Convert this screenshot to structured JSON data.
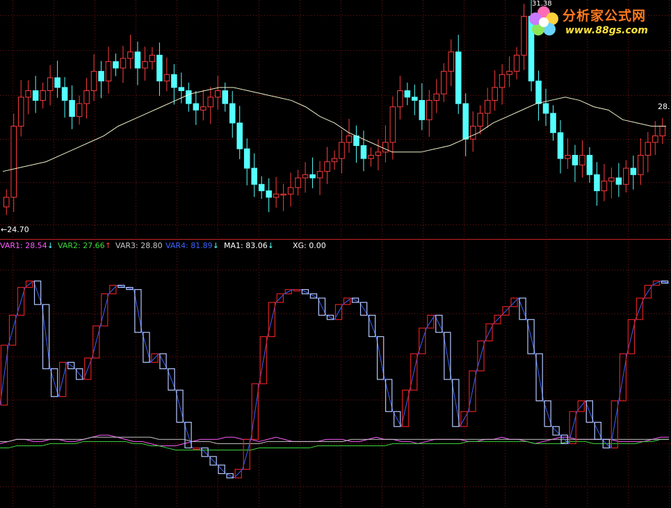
{
  "colors": {
    "background": "#000000",
    "grid": "#7a1212",
    "up": "#ff3c3c",
    "down": "#54ffff",
    "ma_line": "#f0f0c8",
    "divider": "#b41c1c",
    "var1": "#ff5cff",
    "var2": "#3cdc3c",
    "var3": "#c8c8c8",
    "var4": "#3c64ff",
    "ma1": "#ffffff",
    "xg": "#ffffff",
    "osc_up": "#e02020",
    "osc_down": "#b4c8ff"
  },
  "watermark": {
    "brand": "分析家公式网",
    "url": "www.88gs.com",
    "icon": "flower-logo"
  },
  "legend": [
    {
      "label": "VAR1: 28.54",
      "arrow": "↓",
      "arrow_dir": "down",
      "color": "#ff5cff"
    },
    {
      "label": "VAR2: 27.66",
      "arrow": "↑",
      "arrow_dir": "up",
      "color": "#3cdc3c"
    },
    {
      "label": "VAR3: 28.80",
      "arrow": "",
      "color": "#c8c8c8"
    },
    {
      "label": "VAR4: 81.89",
      "arrow": "↓",
      "arrow_dir": "down",
      "color": "#3c64ff"
    },
    {
      "label": "MA1: 83.06",
      "arrow": "↓",
      "arrow_dir": "down",
      "color": "#ffffff"
    },
    {
      "label": "XG: 0.00",
      "arrow": "",
      "color": "#ffffff"
    }
  ],
  "chart_data": [
    {
      "type": "candlestick",
      "panel": "price",
      "min_label": "←24.70",
      "right_label": "28.",
      "top_label": "31.38",
      "ylim": [
        24.5,
        31.6
      ],
      "grid": true,
      "ohlc_closes": [
        25.6,
        27.8,
        28.7,
        28.9,
        28.6,
        28.9,
        29.3,
        29.0,
        28.6,
        28.1,
        28.5,
        28.9,
        29.5,
        29.2,
        29.8,
        29.6,
        29.9,
        30.1,
        29.6,
        29.8,
        30.0,
        29.2,
        29.4,
        29.0,
        28.9,
        28.5,
        28.3,
        28.4,
        28.7,
        28.9,
        28.5,
        27.9,
        27.1,
        26.5,
        26.0,
        25.8,
        25.6,
        25.7,
        25.7,
        25.9,
        26.2,
        26.3,
        26.2,
        26.4,
        26.7,
        26.8,
        27.3,
        27.5,
        27.2,
        26.8,
        26.9,
        27.0,
        27.3,
        28.4,
        28.9,
        28.7,
        28.6,
        28.0,
        28.6,
        28.8,
        29.5,
        30.1,
        28.5,
        27.4,
        27.8,
        28.2,
        28.6,
        29.0,
        29.4,
        29.5,
        30.0,
        31.2,
        29.2,
        28.5,
        28.2,
        27.6,
        26.8,
        26.9,
        26.6,
        26.9,
        26.3,
        25.8,
        26.1,
        26.2,
        26.0,
        26.5,
        26.3,
        26.9,
        27.3,
        27.5,
        27.8
      ],
      "ma_line": [
        26.4,
        26.5,
        26.6,
        26.7,
        26.9,
        27.1,
        27.3,
        27.5,
        27.8,
        28.0,
        28.2,
        28.4,
        28.6,
        28.8,
        28.9,
        29.0,
        29.0,
        28.9,
        28.8,
        28.7,
        28.6,
        28.4,
        28.1,
        27.9,
        27.6,
        27.4,
        27.2,
        27.0,
        27.0,
        27.0,
        27.1,
        27.2,
        27.4,
        27.6,
        27.9,
        28.1,
        28.3,
        28.5,
        28.6,
        28.7,
        28.6,
        28.4,
        28.3,
        28.0,
        27.9,
        27.8,
        27.8
      ]
    },
    {
      "type": "line",
      "panel": "oscillator",
      "ylim": [
        0,
        100
      ],
      "grid": true,
      "series": [
        {
          "name": "VAR4",
          "values": [
            38,
            66,
            80,
            93,
            96,
            85,
            55,
            42,
            58,
            55,
            50,
            60,
            75,
            90,
            94,
            93,
            92,
            72,
            58,
            62,
            55,
            45,
            30,
            18,
            18,
            14,
            10,
            6,
            4,
            8,
            22,
            48,
            70,
            86,
            90,
            92,
            92,
            90,
            88,
            80,
            78,
            85,
            88,
            86,
            80,
            70,
            50,
            35,
            28,
            45,
            62,
            74,
            80,
            72,
            50,
            28,
            35,
            54,
            68,
            76,
            80,
            84,
            88,
            78,
            62,
            40,
            28,
            24,
            20,
            35,
            40,
            30,
            22,
            18,
            40,
            62,
            78,
            88,
            94,
            96,
            95
          ]
        },
        {
          "name": "VAR1",
          "values": [
            20,
            21,
            22,
            22,
            21,
            21,
            22,
            22,
            21,
            21,
            22,
            23,
            24,
            24,
            23,
            22,
            21,
            21,
            20,
            19,
            19,
            19,
            20,
            21,
            22,
            22,
            22,
            23,
            23,
            22,
            22,
            21,
            22,
            23,
            22,
            21,
            21,
            21,
            21,
            22,
            22,
            22,
            21,
            21,
            22,
            23,
            22,
            22,
            21,
            21,
            20,
            21,
            22,
            22,
            22,
            22,
            21,
            21,
            22,
            22,
            23,
            22,
            22,
            21,
            20,
            21,
            22,
            23,
            23,
            22,
            22,
            22,
            22,
            22,
            21,
            21,
            21,
            21,
            22,
            23,
            23
          ]
        },
        {
          "name": "VAR2",
          "values": [
            18,
            18,
            19,
            19,
            19,
            19,
            20,
            20,
            20,
            20,
            21,
            21,
            21,
            21,
            21,
            21,
            20,
            20,
            19,
            19,
            18,
            17,
            17,
            17,
            17,
            17,
            17,
            17,
            17,
            17,
            17,
            18,
            18,
            18,
            18,
            18,
            18,
            18,
            19,
            19,
            19,
            19,
            19,
            19,
            19,
            19,
            19,
            20,
            20,
            20,
            20,
            20,
            20,
            20,
            20,
            20,
            21,
            21,
            21,
            21,
            21,
            21,
            21,
            21,
            20,
            20,
            20,
            20,
            21,
            21,
            21,
            20,
            20,
            20,
            20,
            20,
            20,
            21,
            21,
            22,
            22
          ]
        },
        {
          "name": "VAR3",
          "values": [
            21,
            21,
            22,
            22,
            22,
            22,
            22,
            22,
            22,
            22,
            22,
            23,
            23,
            23,
            23,
            23,
            23,
            23,
            23,
            22,
            22,
            22,
            22,
            21,
            21,
            21,
            20,
            20,
            20,
            20,
            20,
            20,
            21,
            21,
            21,
            21,
            21,
            21,
            21,
            21,
            21,
            21,
            22,
            22,
            22,
            22,
            22,
            22,
            22,
            22,
            22,
            22,
            22,
            22,
            22,
            22,
            22,
            22,
            22,
            22,
            22,
            22,
            22,
            22,
            22,
            22,
            22,
            22,
            22,
            22,
            22,
            22,
            22,
            22,
            22,
            22,
            22,
            22,
            22,
            22,
            22
          ]
        }
      ]
    }
  ]
}
